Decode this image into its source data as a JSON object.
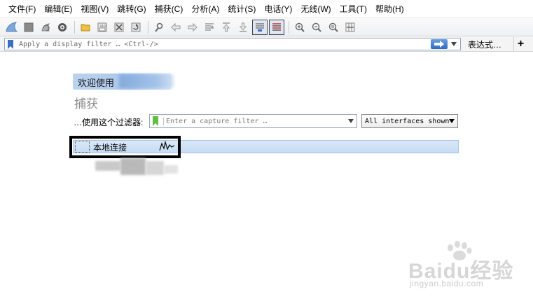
{
  "menu": {
    "items": [
      {
        "label": "文件(F)"
      },
      {
        "label": "编辑(E)"
      },
      {
        "label": "视图(V)"
      },
      {
        "label": "跳转(G)"
      },
      {
        "label": "捕获(C)"
      },
      {
        "label": "分析(A)"
      },
      {
        "label": "统计(S)"
      },
      {
        "label": "电话(Y)"
      },
      {
        "label": "无线(W)"
      },
      {
        "label": "工具(T)"
      },
      {
        "label": "帮助(H)"
      }
    ]
  },
  "toolbar": {
    "icons": [
      "shark-fin-start-icon",
      "stop-icon",
      "restart-icon",
      "options-gear-icon",
      "open-folder-icon",
      "save-file-icon",
      "close-file-icon",
      "reload-icon",
      "find-icon",
      "go-back-icon",
      "go-forward-icon",
      "go-to-packet-icon",
      "go-first-icon",
      "go-last-icon",
      "autoscroll-icon",
      "colorize-icon",
      "zoom-in-icon",
      "zoom-out-icon",
      "zoom-normal-icon",
      "resize-columns-icon"
    ]
  },
  "display_filter": {
    "placeholder": "Apply a display filter … <Ctrl-/>",
    "expression_label": "表达式…",
    "add_label": "+"
  },
  "welcome": {
    "greeting": "欢迎使用",
    "capture_title": "捕获",
    "filter_label": "…使用这个过滤器:",
    "capture_filter_placeholder": "Enter a capture filter …",
    "interfaces_select": "All interfaces shown",
    "interfaces": [
      {
        "name": "本地连接"
      }
    ]
  },
  "watermark": {
    "text": "Baidu经验",
    "sub": "jingyan.baidu.com"
  },
  "colors": {
    "accent_blue": "#2f6cc0",
    "interface_row": "#c6dcf3",
    "bookmark_green": "#5fbf3f"
  }
}
